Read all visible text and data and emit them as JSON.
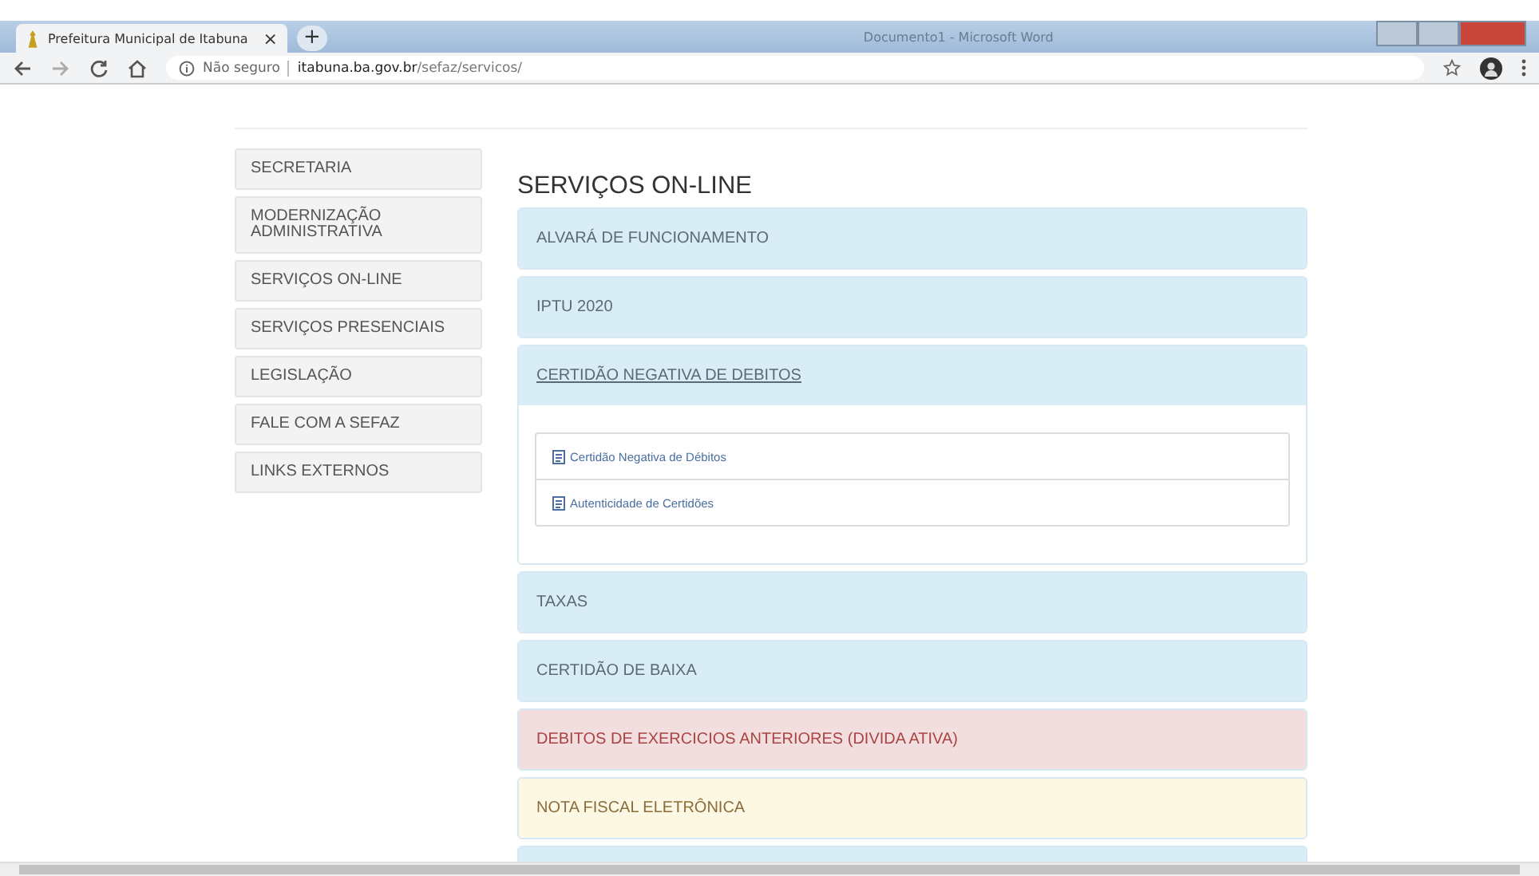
{
  "browser": {
    "tab_title": "Prefeitura Municipal de Itabuna",
    "tab_close": "×",
    "new_tab": "+",
    "background_window_title": "Documento1 - Microsoft Word",
    "security": "Não seguro",
    "url_host": "itabuna.ba.gov.br",
    "url_path": "/sefaz/servicos/"
  },
  "sidebar": {
    "items": [
      {
        "label": "SECRETARIA"
      },
      {
        "label": "MODERNIZAÇÃO ADMINISTRATIVA"
      },
      {
        "label": "SERVIÇOS ON-LINE"
      },
      {
        "label": "SERVIÇOS PRESENCIAIS"
      },
      {
        "label": "LEGISLAÇÃO"
      },
      {
        "label": "FALE COM A SEFAZ"
      },
      {
        "label": "LINKS EXTERNOS"
      }
    ]
  },
  "main": {
    "title": "SERVIÇOS ON-LINE",
    "panels": [
      {
        "title": "ALVARÁ DE FUNCIONAMENTO",
        "color": "#d9edf7",
        "expanded": false
      },
      {
        "title": "IPTU 2020",
        "color": "#d9edf7",
        "expanded": false
      },
      {
        "title": "CERTIDÃO NEGATIVA DE DEBITOS",
        "color": "#d9edf7",
        "expanded": true,
        "links": [
          "Certidão Negativa de Débitos",
          "Autenticidade de Certidões"
        ]
      },
      {
        "title": "TAXAS",
        "color": "#d9edf7",
        "expanded": false
      },
      {
        "title": "CERTIDÃO DE BAIXA",
        "color": "#d9edf7",
        "expanded": false
      },
      {
        "title": "DEBITOS DE EXERCICIOS ANTERIORES (DIVIDA ATIVA)",
        "color": "#f2dede",
        "expanded": false
      },
      {
        "title": "NOTA FISCAL ELETRÔNICA",
        "color": "#fcf8e3",
        "expanded": false
      },
      {
        "color": "#d9edf7",
        "expanded": false
      }
    ]
  }
}
